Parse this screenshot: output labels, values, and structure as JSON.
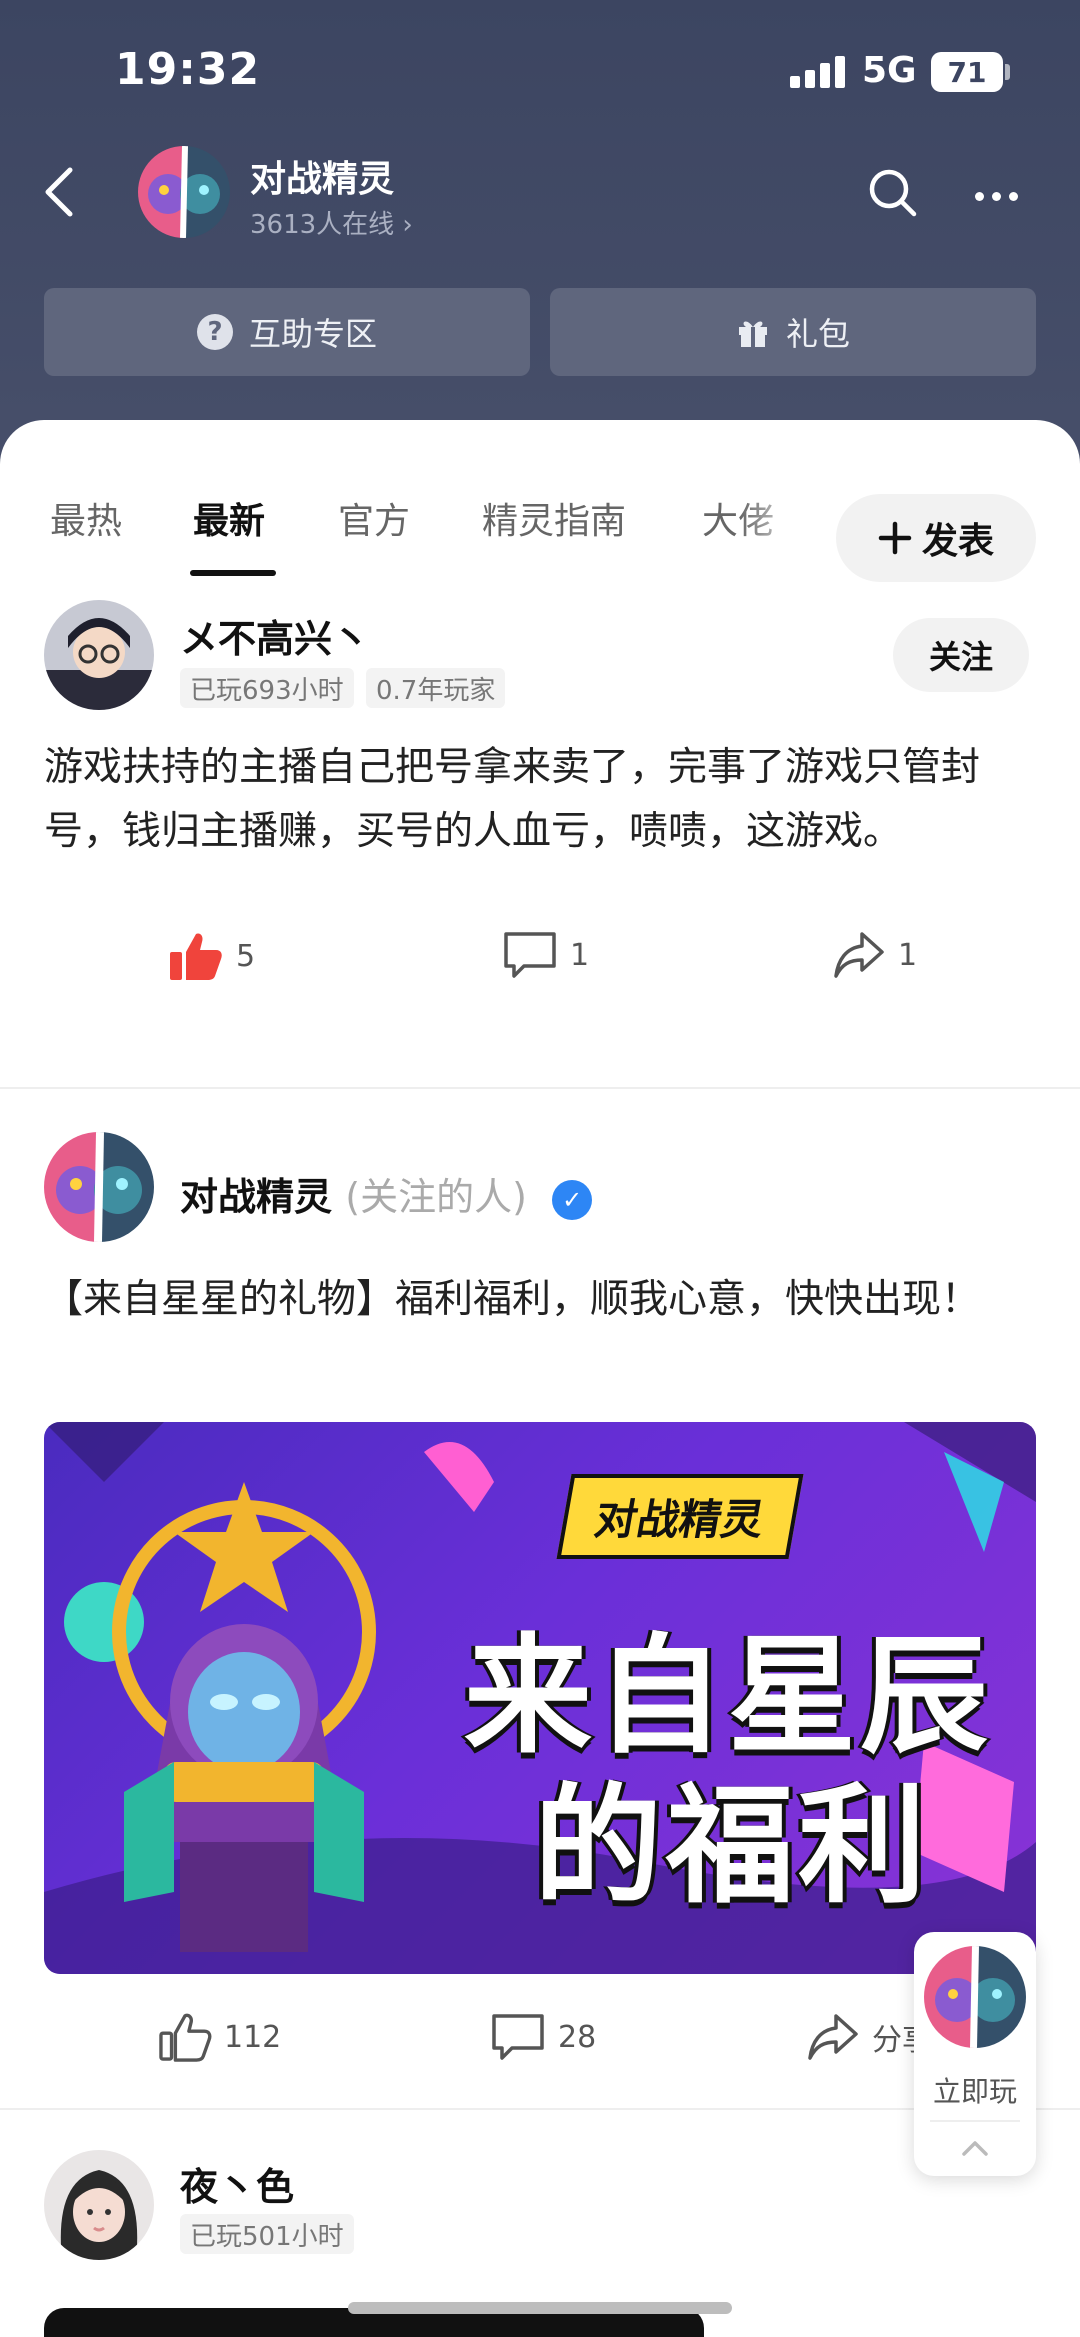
{
  "status_bar": {
    "time": "19:32",
    "network": "5G",
    "battery": "71"
  },
  "header": {
    "title": "对战精灵",
    "online": "3613人在线",
    "quick_buttons": [
      {
        "label": "互助专区",
        "icon": "question-icon"
      },
      {
        "label": "礼包",
        "icon": "gift-icon"
      }
    ]
  },
  "tabs": [
    "最热",
    "最新",
    "官方",
    "精灵指南",
    "大佬"
  ],
  "active_tab": "最新",
  "post_button": "发表",
  "posts": [
    {
      "author": "メ不高兴丶",
      "badges": [
        "已玩693小时",
        "0.7年玩家"
      ],
      "follow_label": "关注",
      "text": "游戏扶持的主播自己把号拿来卖了，完事了游戏只管封号，钱归主播赚，买号的人血亏，啧啧，这游戏。",
      "likes": "5",
      "comments": "1",
      "shares": "1"
    },
    {
      "author": "对战精灵",
      "author_note": "(关注的人)",
      "text": "【来自星星的礼物】福利福利，顺我心意，快快出现！",
      "banner": {
        "tag": "对战精灵",
        "line1": "来自星辰",
        "line2": "的福利"
      },
      "likes": "112",
      "comments": "28",
      "shares": "分享"
    },
    {
      "author": "夜丶色",
      "badges": [
        "已玩501小时"
      ]
    }
  ],
  "float_button": {
    "label": "立即玩"
  },
  "colors": {
    "header_bg": "#3c4561",
    "like_active": "#f0443c",
    "verified": "#2d86f5"
  }
}
